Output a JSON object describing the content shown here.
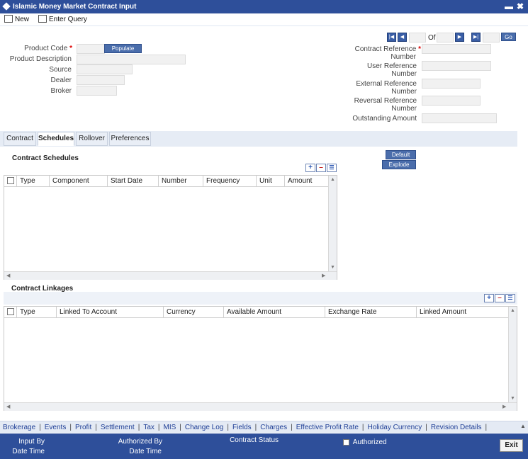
{
  "window": {
    "title": "Islamic Money Market Contract Input",
    "minimize": "▬",
    "close": "✖"
  },
  "toolbar": {
    "new_label": "New",
    "enter_query_label": "Enter Query"
  },
  "header_left": {
    "product_code_label": "Product Code",
    "populate_label": "Populate",
    "product_description_label": "Product Description",
    "source_label": "Source",
    "dealer_label": "Dealer",
    "broker_label": "Broker"
  },
  "header_right": {
    "of_label": "Of",
    "go_label": "Go",
    "contract_ref_label_1": "Contract Reference",
    "contract_ref_label_2": "Number",
    "user_ref_label_1": "User Reference",
    "user_ref_label_2": "Number",
    "external_ref_label_1": "External Reference",
    "external_ref_label_2": "Number",
    "reversal_ref_label_1": "Reversal Reference",
    "reversal_ref_label_2": "Number",
    "outstanding_label": "Outstanding Amount"
  },
  "required_mark": "*",
  "tabs": [
    "Contract",
    "Schedules",
    "Rollover",
    "Preferences"
  ],
  "schedules": {
    "title": "Contract Schedules",
    "default_label": "Default",
    "explode_label": "Explode",
    "columns": [
      "Type",
      "Component",
      "Start Date",
      "Number",
      "Frequency",
      "Unit",
      "Amount"
    ]
  },
  "linkages": {
    "title": "Contract Linkages",
    "columns": [
      "Type",
      "Linked To Account",
      "Currency",
      "Available Amount",
      "Exchange Rate",
      "Linked Amount"
    ]
  },
  "links": [
    "Brokerage",
    "Events",
    "Profit",
    "Settlement",
    "Tax",
    "MIS",
    "Change Log",
    "Fields",
    "Charges",
    "Effective Profit Rate",
    "Holiday Currency",
    "Revision Details"
  ],
  "footer": {
    "input_by": "Input By",
    "date_time_1": "Date Time",
    "authorized_by": "Authorized By",
    "date_time_2": "Date Time",
    "contract_status": "Contract Status",
    "authorized": "Authorized",
    "exit": "Exit"
  },
  "colors": {
    "title_bar": "#2e4f9a",
    "accent_button": "#4a6dab",
    "tab_bar": "#e6ecf5",
    "required": "#dd0000"
  }
}
